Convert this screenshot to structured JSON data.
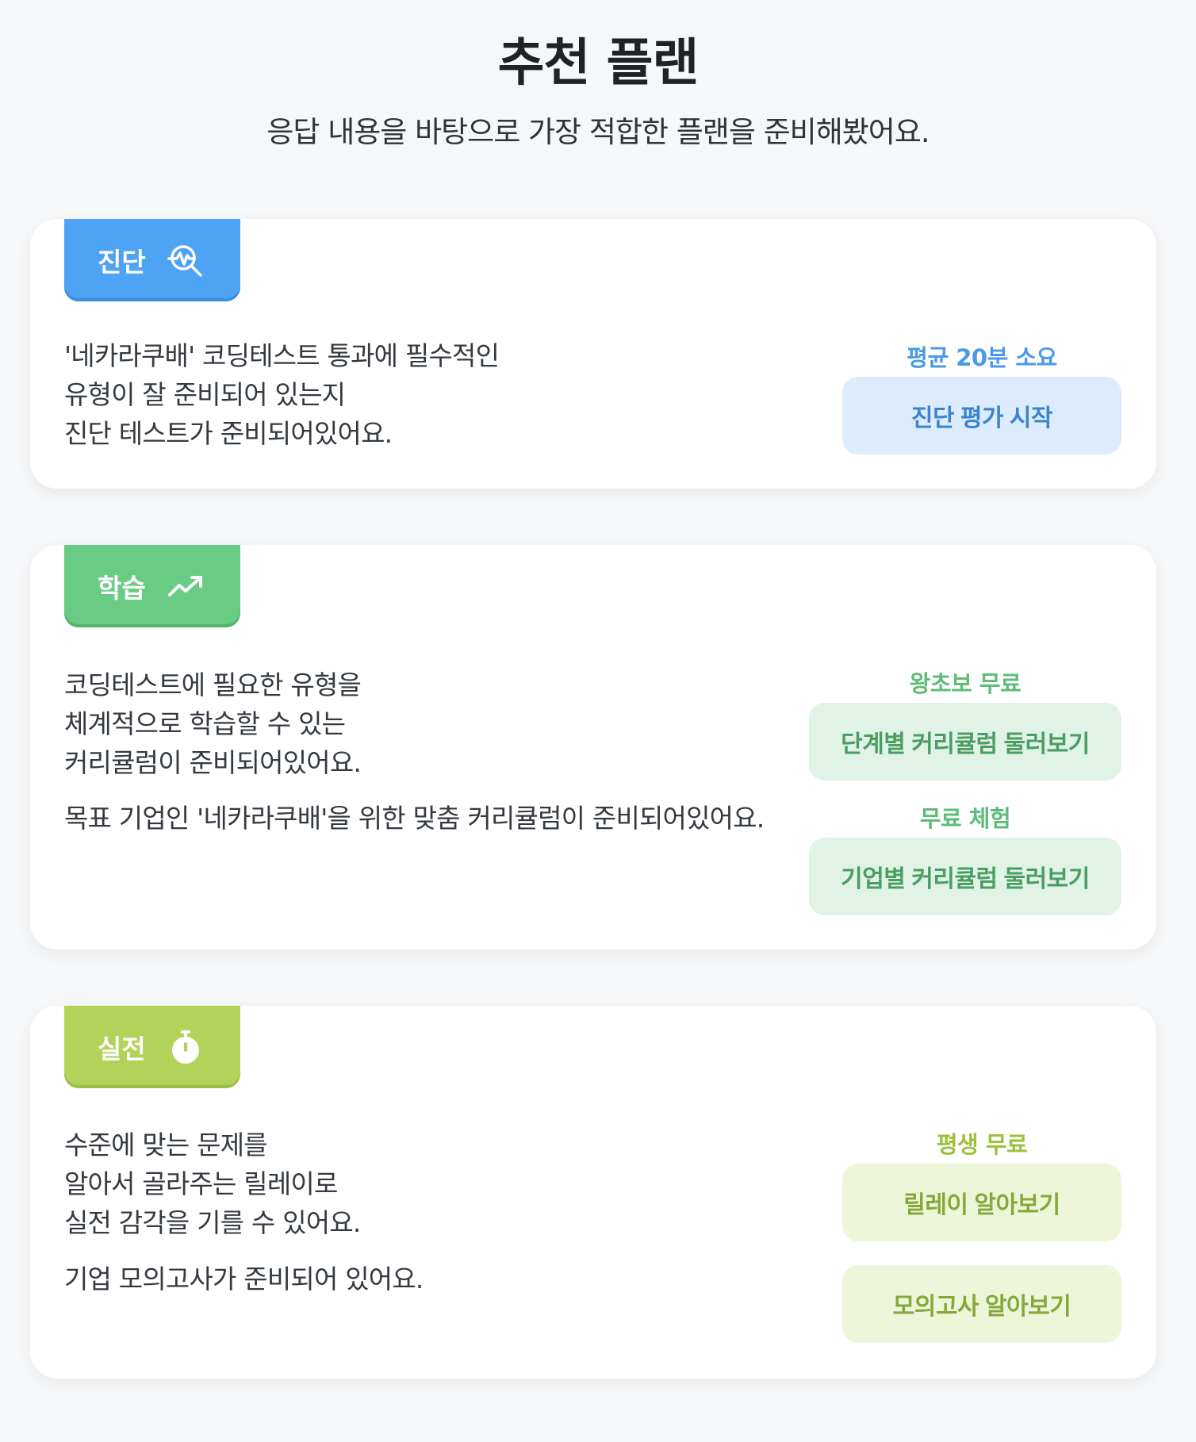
{
  "header": {
    "title": "추천 플랜",
    "subtitle": "응답 내용을 바탕으로 가장 적합한 플랜을 준비해봤어요."
  },
  "colors": {
    "diagnosis": "#4ea3f5",
    "study": "#6acb84",
    "practice": "#b1d35a",
    "background": "#f6f7f9"
  },
  "cards": [
    {
      "tag": "진단",
      "tag_icon": "diagnosis-search-icon",
      "desc_lines_1": [
        "'네카라쿠배' 코딩테스트 통과에 필수적인",
        "유형이 잘 준비되어 있는지",
        "진단 테스트가 준비되어있어요."
      ],
      "actions": [
        {
          "label": "평균 20분 소요",
          "button": "진단 평가 시작"
        }
      ]
    },
    {
      "tag": "학습",
      "tag_icon": "trending-up-icon",
      "desc_lines_1": [
        "코딩테스트에 필요한 유형을",
        "체계적으로 학습할 수 있는",
        "커리큘럼이 준비되어있어요."
      ],
      "desc_lines_2": [
        "목표 기업인 '네카라쿠배'을 위한 맞춤 커리큘럼이 준비되어있어요."
      ],
      "actions": [
        {
          "label": "왕초보 무료",
          "button": "단계별 커리큘럼 둘러보기"
        },
        {
          "label": "무료 체험",
          "button": "기업별 커리큘럼 둘러보기"
        }
      ]
    },
    {
      "tag": "실전",
      "tag_icon": "stopwatch-icon",
      "desc_lines_1": [
        "수준에 맞는 문제를",
        "알아서 골라주는 릴레이로",
        "실전 감각을 기를 수 있어요."
      ],
      "desc_lines_2": [
        "기업 모의고사가 준비되어 있어요."
      ],
      "actions": [
        {
          "label": "평생 무료",
          "button": "릴레이 알아보기"
        },
        {
          "label": "",
          "button": "모의고사 알아보기"
        }
      ]
    }
  ]
}
